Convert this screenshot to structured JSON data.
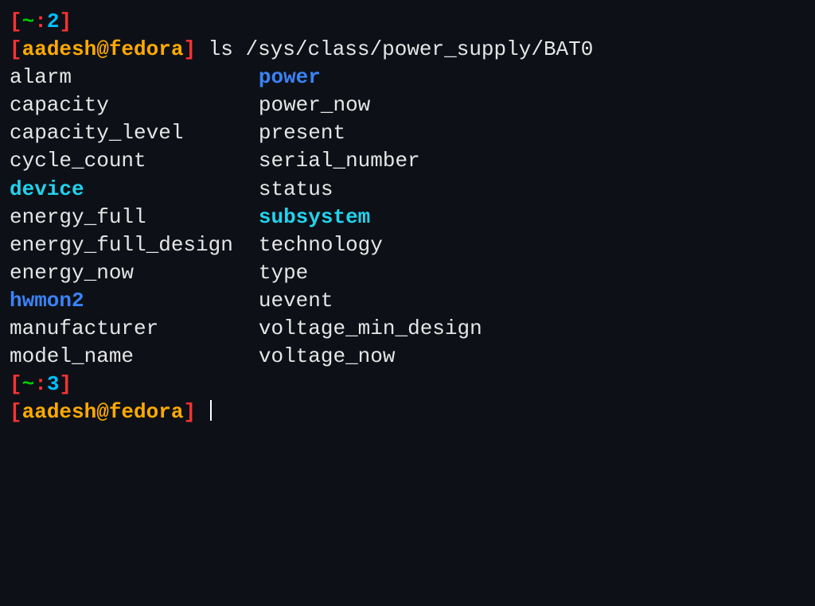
{
  "prompt1": {
    "open_bracket": "[",
    "tilde": "~",
    "colon": ":",
    "num": "2",
    "close_bracket": "]"
  },
  "prompt1_line": {
    "open_bracket": "[",
    "user_host": "aadesh@fedora",
    "close_bracket": "]",
    "command": "ls /sys/class/power_supply/BAT0"
  },
  "listing": {
    "col1": [
      {
        "name": "alarm",
        "type": "regular"
      },
      {
        "name": "capacity",
        "type": "regular"
      },
      {
        "name": "capacity_level",
        "type": "regular"
      },
      {
        "name": "cycle_count",
        "type": "regular"
      },
      {
        "name": "device",
        "type": "cyan"
      },
      {
        "name": "energy_full",
        "type": "regular"
      },
      {
        "name": "energy_full_design",
        "type": "regular"
      },
      {
        "name": "energy_now",
        "type": "regular"
      },
      {
        "name": "hwmon2",
        "type": "blue"
      },
      {
        "name": "manufacturer",
        "type": "regular"
      },
      {
        "name": "model_name",
        "type": "regular"
      }
    ],
    "col2": [
      {
        "name": "power",
        "type": "blue"
      },
      {
        "name": "power_now",
        "type": "regular"
      },
      {
        "name": "present",
        "type": "regular"
      },
      {
        "name": "serial_number",
        "type": "regular"
      },
      {
        "name": "status",
        "type": "regular"
      },
      {
        "name": "subsystem",
        "type": "cyan"
      },
      {
        "name": "technology",
        "type": "regular"
      },
      {
        "name": "type",
        "type": "regular"
      },
      {
        "name": "uevent",
        "type": "regular"
      },
      {
        "name": "voltage_min_design",
        "type": "regular"
      },
      {
        "name": "voltage_now",
        "type": "regular"
      }
    ]
  },
  "prompt2": {
    "open_bracket": "[",
    "tilde": "~",
    "colon": ":",
    "num": "3",
    "close_bracket": "]"
  },
  "prompt2_line": {
    "open_bracket": "[",
    "user_host": "aadesh@fedora",
    "close_bracket": "]"
  }
}
